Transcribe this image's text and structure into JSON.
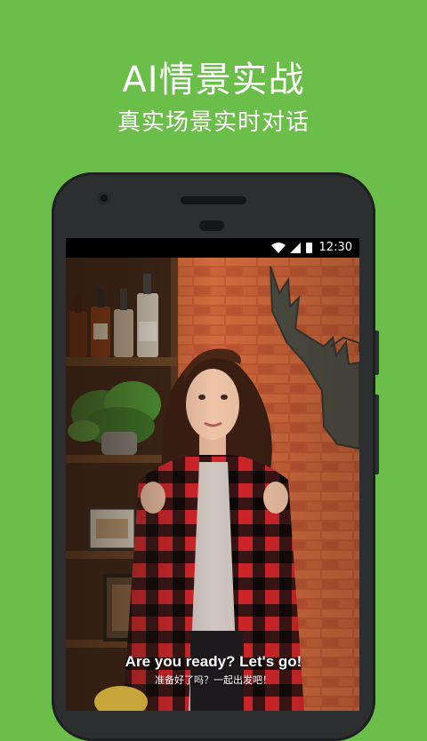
{
  "header": {
    "title": "AI情景实战",
    "subtitle": "真实场景实时对话"
  },
  "status_bar": {
    "time": "12:30",
    "icons": [
      "wifi-icon",
      "signal-icon",
      "battery-icon"
    ]
  },
  "video": {
    "caption_en": "Are you ready? Let's go!",
    "caption_zh": "准备好了吗？一起出发吧！"
  },
  "colors": {
    "background": "#6cbe4a",
    "phone_body": "#2c2e30",
    "text": "#ffffff"
  }
}
